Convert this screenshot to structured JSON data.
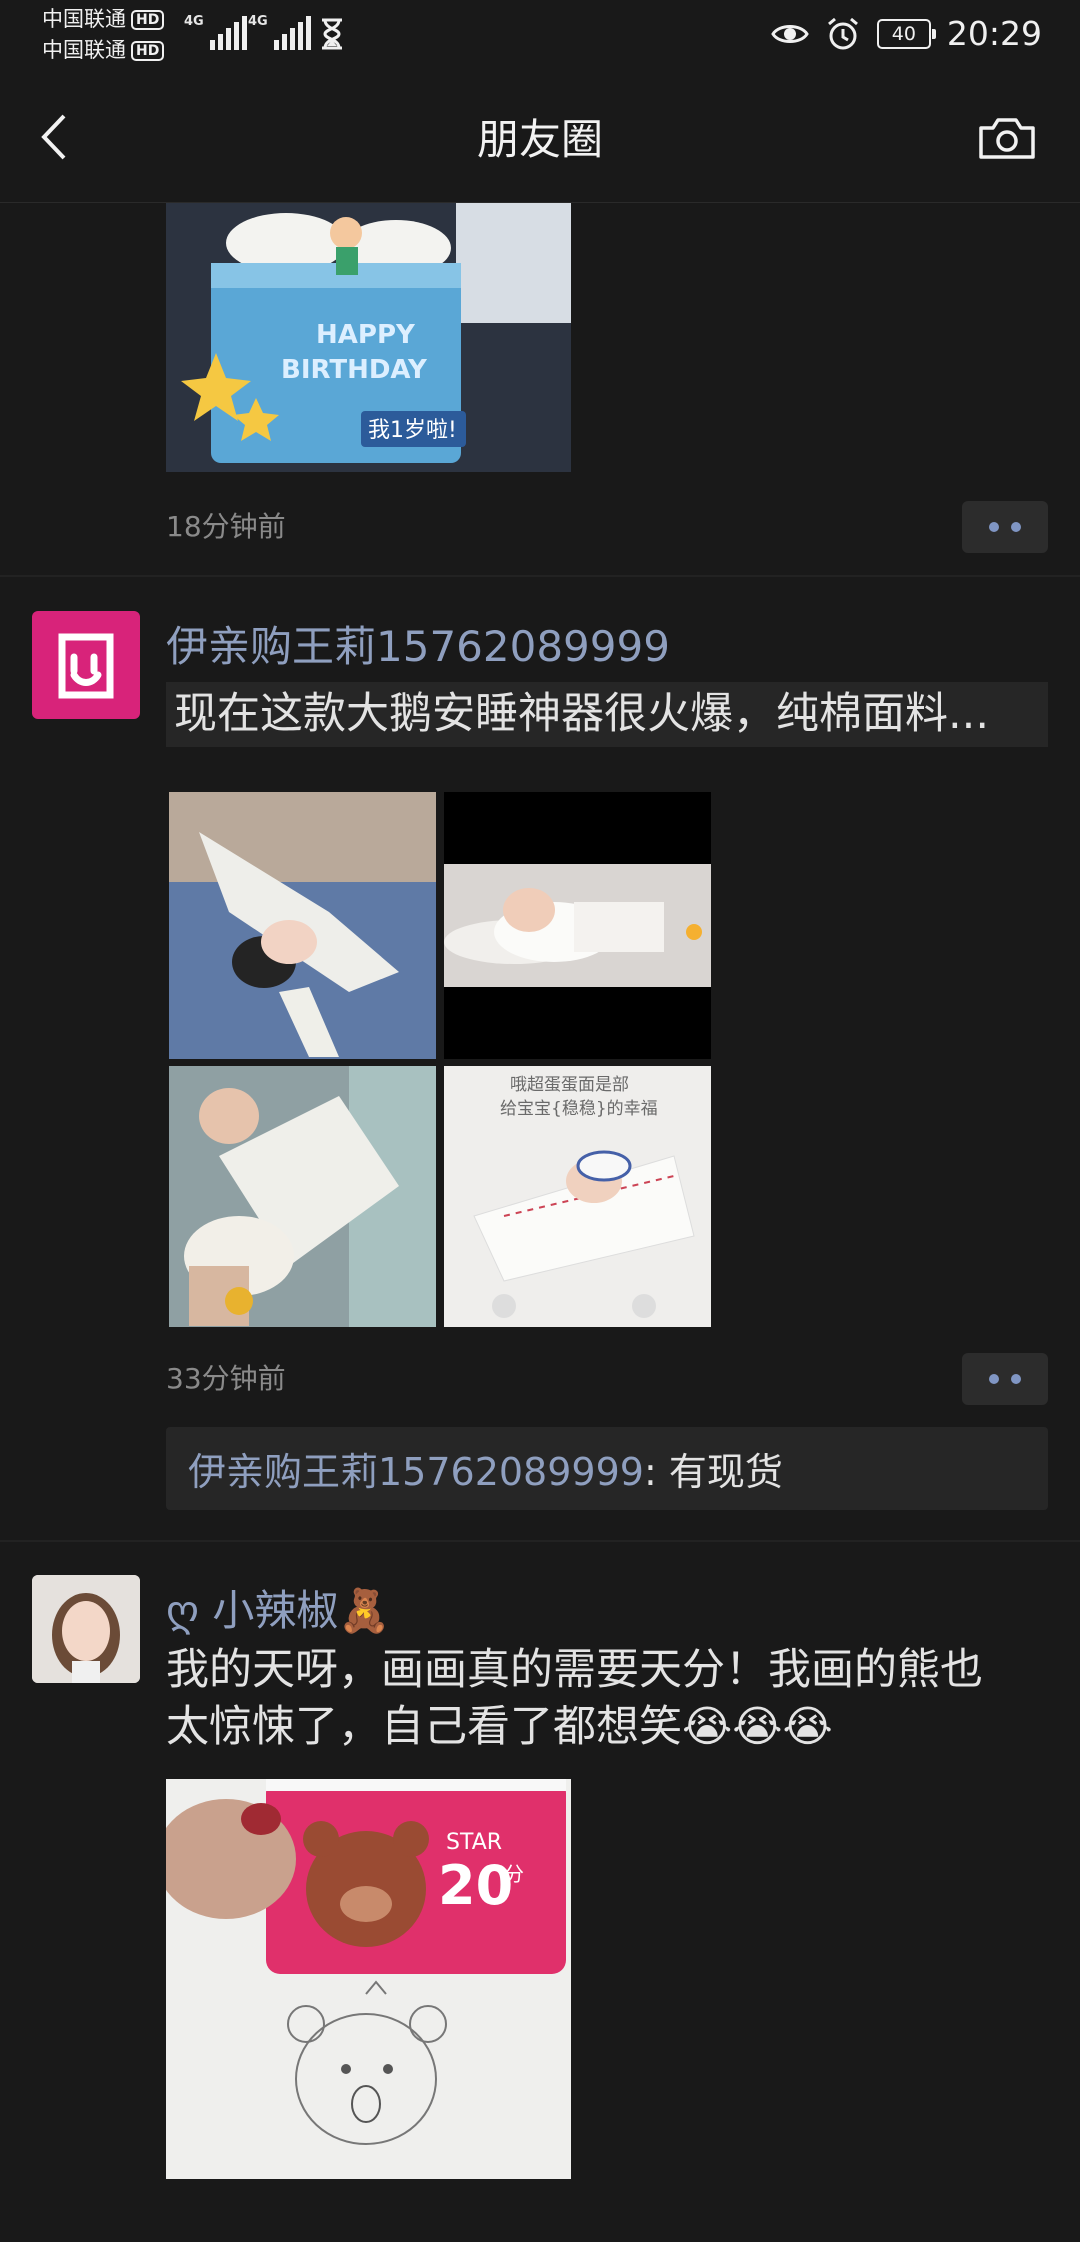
{
  "status": {
    "carrier1": "中国联通",
    "carrier2": "中国联通",
    "hd_label": "HD",
    "net_label": "4G",
    "battery": "40",
    "time": "20:29"
  },
  "nav": {
    "title": "朋友圈"
  },
  "posts": [
    {
      "time": "18分钟前"
    },
    {
      "author": "伊亲购王莉15762089999",
      "text": "现在这款大鹅安睡神器很火爆，纯棉面料...",
      "time": "33分钟前",
      "comment_author": "伊亲购王莉15762089999",
      "comment_sep": ": ",
      "comment_text": "有现货",
      "img3_text1": "哦超蛋蛋面是部",
      "img3_text2": "给宝宝{稳稳}的幸福"
    },
    {
      "author": "ღ 小辣椒🧸",
      "text": "我的天呀，画画真的需要天分！我画的熊也太惊悚了，自己看了都想笑😭😭😭",
      "card_star": "STAR",
      "card_num": "20",
      "card_unit": "分"
    }
  ],
  "cake": {
    "happy": "HAPPY",
    "birthday": "BIRTHDAY",
    "sign": "我1岁啦!"
  }
}
